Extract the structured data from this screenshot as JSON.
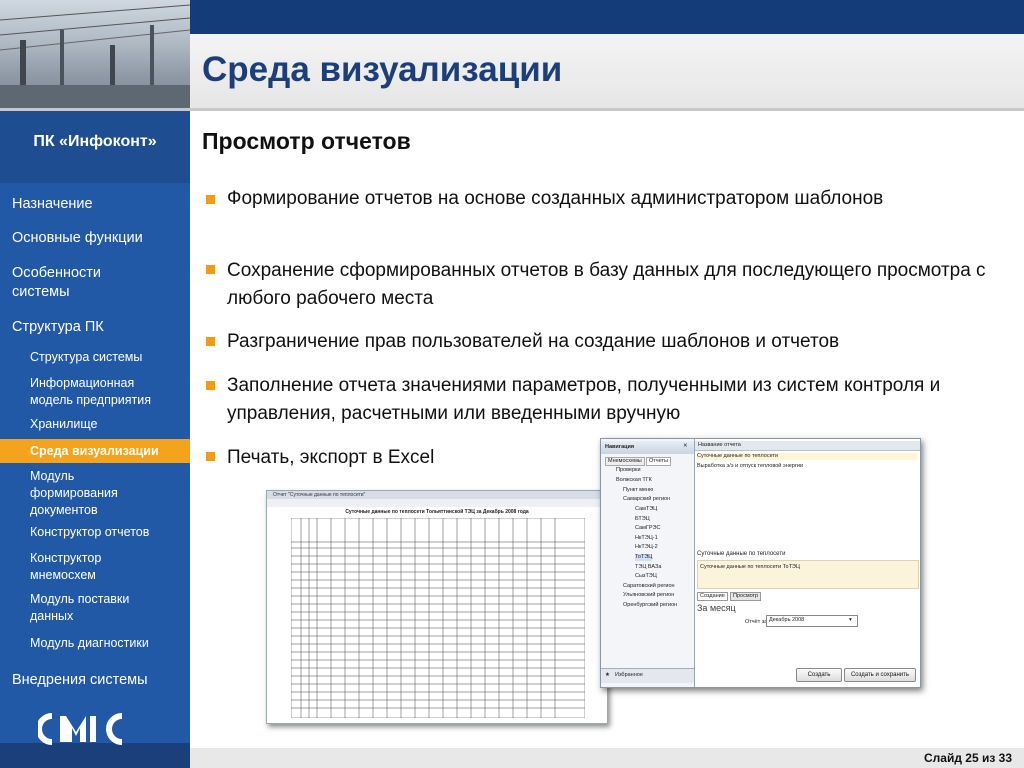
{
  "header": {
    "title": "Среда визуализации",
    "subtitle": "Просмотр отчетов"
  },
  "sidebar": {
    "product": "ПК «Инфоконт»",
    "items": [
      {
        "label": "Назначение",
        "level": 1
      },
      {
        "label": "Основные функции",
        "level": 1
      },
      {
        "label": "Особенности системы",
        "level": 1
      },
      {
        "label": "Структура ПК",
        "level": 1
      },
      {
        "label": "Структура системы",
        "level": 2
      },
      {
        "label": "Информационная модель предприятия",
        "level": 2
      },
      {
        "label": "Хранилище",
        "level": 2
      },
      {
        "label": "Среда визуализации",
        "level": 2,
        "active": true
      },
      {
        "label": "Модуль формирования документов",
        "level": 2
      },
      {
        "label": "Конструктор отчетов",
        "level": 2
      },
      {
        "label": "Конструктор мнемосхем",
        "level": 2
      },
      {
        "label": "Модуль поставки данных",
        "level": 2
      },
      {
        "label": "Модуль диагностики",
        "level": 2
      },
      {
        "label": "Внедрения системы",
        "level": 1
      }
    ]
  },
  "bullets": [
    "Формирование отчетов на основе созданных администратором шаблонов",
    "Сохранение сформированных отчетов в базу данных для последующего просмотра с любого рабочего места",
    "Разграничение прав пользователей на создание шаблонов и отчетов",
    "Заполнение отчета значениями параметров, полученными из систем контроля и управления, расчетными или введенными вручную",
    "Печать, экспорт в Excel"
  ],
  "report_preview": {
    "window_title": "Отчет \"Суточные данные по теплосети\"",
    "table_title": "Суточные данные по теплосети Тольяттинской ТЭЦ за Декабрь 2008 года"
  },
  "app_window": {
    "nav_title": "Навигация",
    "tabs": [
      "Мнемосхемы",
      "Отчеты"
    ],
    "tree": [
      "Проверки",
      "Волжская ТГК",
      "Пункт меню",
      "Самарский регион",
      "СамТЭЦ",
      "БТЭЦ",
      "СамГРЭС",
      "НкТЭЦ-1",
      "НкТЭЦ-2",
      "ТоТЭЦ",
      "ТЭЦ ВАЗа",
      "СызТЭЦ",
      "Саратовский регион",
      "Ульяновский регион",
      "Оренбургский регион"
    ],
    "favorites_label": "Избранное",
    "report_col_header": "Название отчета",
    "reports": [
      "Суточные данные по теплосети",
      "Выработка э/э и отпуск тепловой энергии"
    ],
    "selected_title": "Суточные данные по теплосети",
    "selected_desc": "Суточные данные по теплосети ТоТЭЦ",
    "bottom_tabs": [
      "Создание",
      "Просмотр"
    ],
    "period_label": "За месяц",
    "report_for_label": "Отчёт за",
    "report_for_value": "Декабрь 2008",
    "create_button": "Создать",
    "create_save_button": "Создать и сохранить"
  },
  "footer": {
    "slide": "Слайд 25 из 33"
  },
  "colors": {
    "brand_dark": "#133c78",
    "menu_blue": "#2259a6",
    "accent_orange": "#f19a1c"
  }
}
